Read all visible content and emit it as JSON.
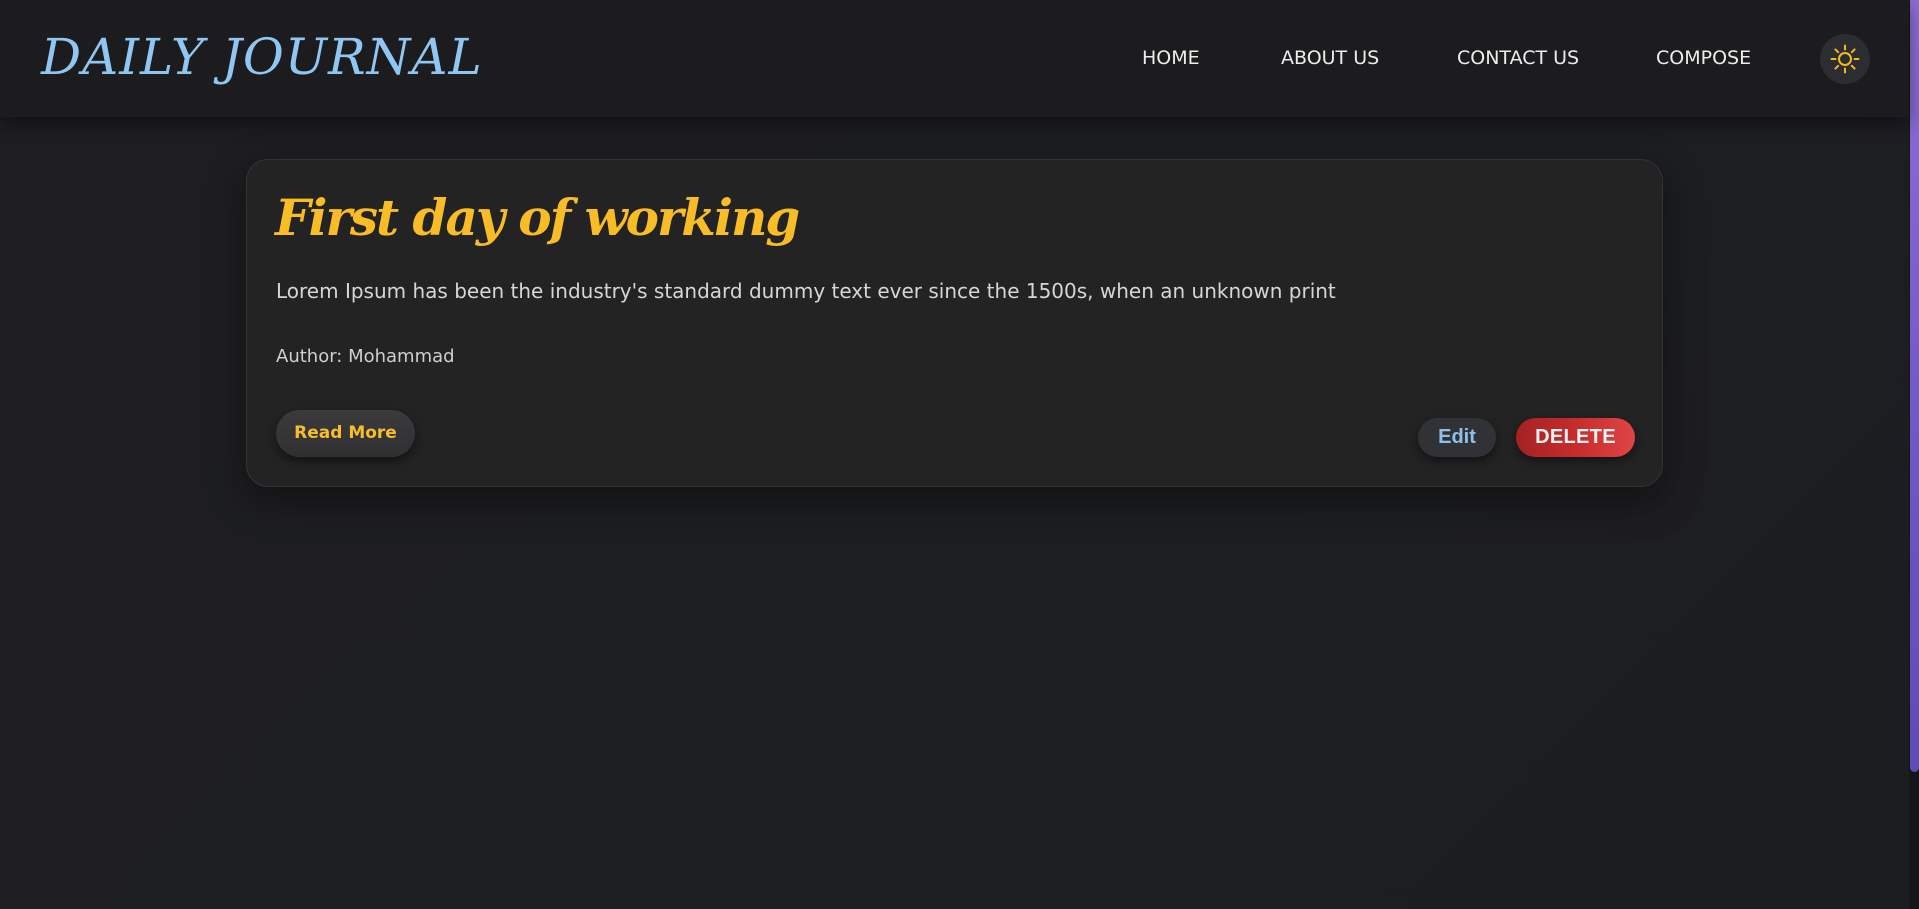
{
  "navbar": {
    "brand": "DAILY JOURNAL",
    "links": [
      {
        "label": "HOME"
      },
      {
        "label": "ABOUT US"
      },
      {
        "label": "CONTACT US"
      },
      {
        "label": "COMPOSE"
      }
    ],
    "theme_toggle_icon": "sun-icon"
  },
  "post": {
    "title": "First day of working",
    "body": "Lorem Ipsum has been the industry's standard dummy text ever since the 1500s, when an unknown print",
    "author": "Author: Mohammad",
    "read_more_label": "Read More",
    "edit_label": "Edit",
    "delete_label": "DELETE"
  },
  "colors": {
    "background": "#1d1e20",
    "navbar": "#1c1c1f",
    "brand": "#8fc7f2",
    "title_accent": "#f8bd26",
    "edit_text": "#8fc0eb",
    "delete": "#c62c2c",
    "scrollbar": "#7a5fcc"
  }
}
